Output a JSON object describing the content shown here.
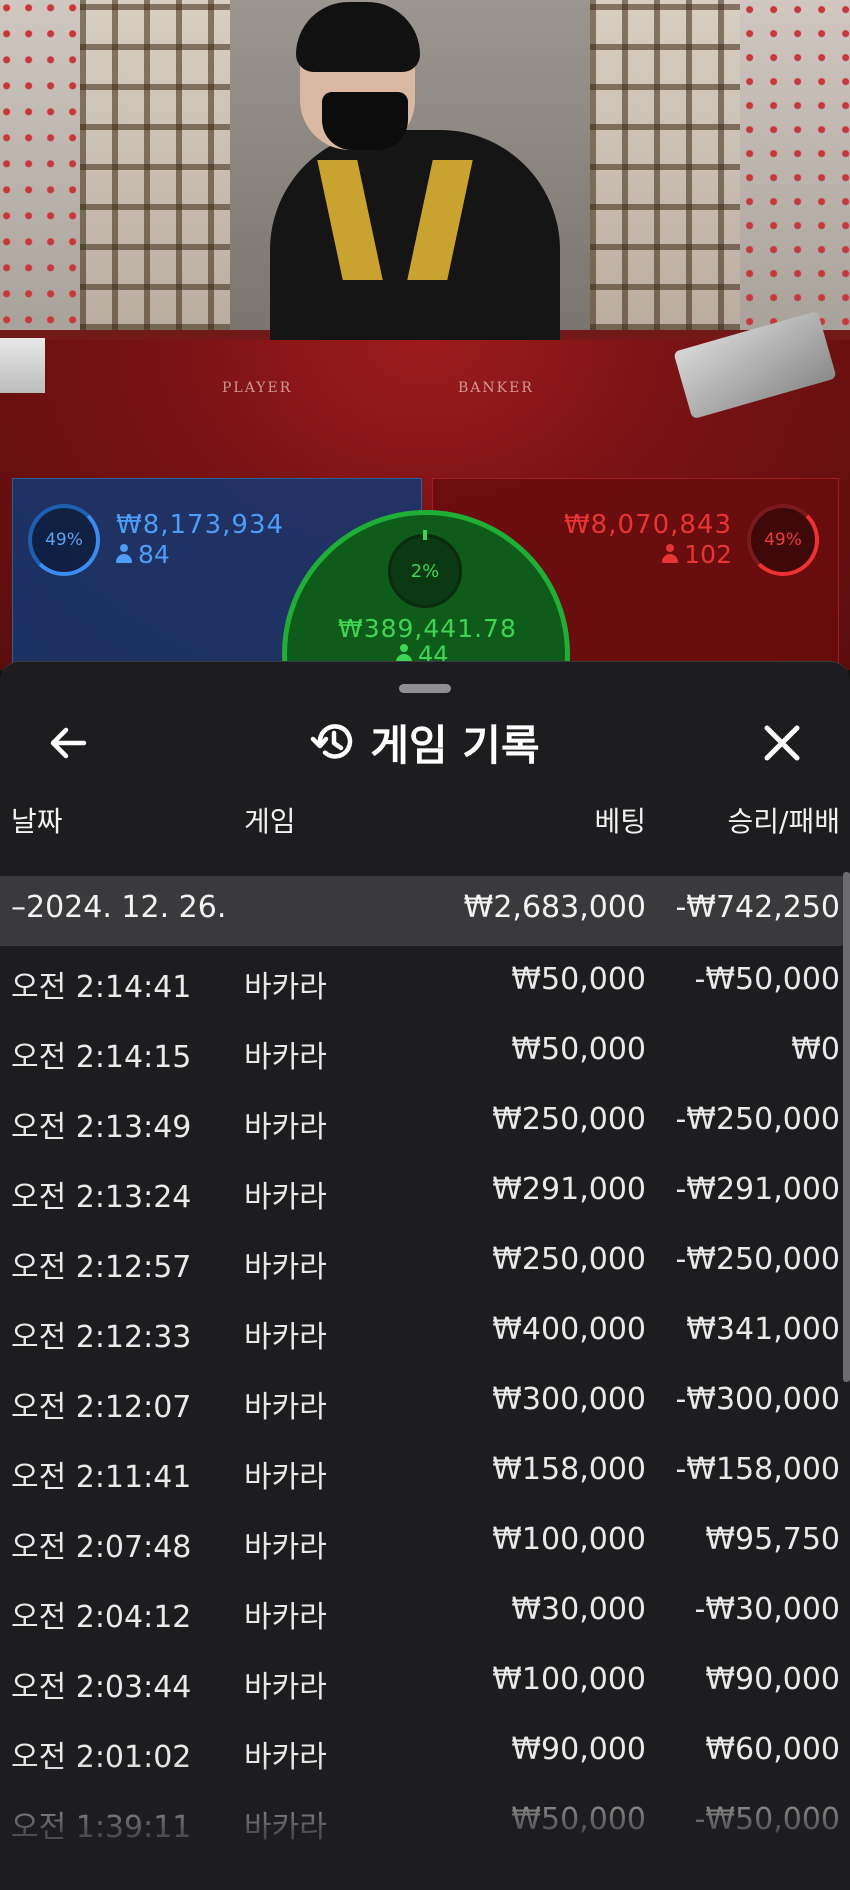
{
  "table": {
    "player_label": "PLAYER",
    "banker_label": "BANKER"
  },
  "bets": {
    "player": {
      "percent": "49%",
      "amount": "₩8,173,934",
      "players": "84"
    },
    "banker": {
      "percent": "49%",
      "amount": "₩8,070,843",
      "players": "102"
    },
    "tie": {
      "percent": "2%",
      "amount": "₩389,441.78",
      "players": "44"
    }
  },
  "history": {
    "title": "게임 기록",
    "columns": {
      "date": "날짜",
      "game": "게임",
      "bet": "베팅",
      "result": "승리/패배"
    },
    "date_group": {
      "date": "–2024. 12. 26.",
      "bet": "₩2,683,000",
      "result": "-₩742,250"
    },
    "rows": [
      {
        "time": "오전 2:14:41",
        "game": "바카라",
        "bet": "₩50,000",
        "result": "-₩50,000"
      },
      {
        "time": "오전 2:14:15",
        "game": "바카라",
        "bet": "₩50,000",
        "result": "₩0"
      },
      {
        "time": "오전 2:13:49",
        "game": "바카라",
        "bet": "₩250,000",
        "result": "-₩250,000"
      },
      {
        "time": "오전 2:13:24",
        "game": "바카라",
        "bet": "₩291,000",
        "result": "-₩291,000"
      },
      {
        "time": "오전 2:12:57",
        "game": "바카라",
        "bet": "₩250,000",
        "result": "-₩250,000"
      },
      {
        "time": "오전 2:12:33",
        "game": "바카라",
        "bet": "₩400,000",
        "result": "₩341,000"
      },
      {
        "time": "오전 2:12:07",
        "game": "바카라",
        "bet": "₩300,000",
        "result": "-₩300,000"
      },
      {
        "time": "오전 2:11:41",
        "game": "바카라",
        "bet": "₩158,000",
        "result": "-₩158,000"
      },
      {
        "time": "오전 2:07:48",
        "game": "바카라",
        "bet": "₩100,000",
        "result": "₩95,750"
      },
      {
        "time": "오전 2:04:12",
        "game": "바카라",
        "bet": "₩30,000",
        "result": "-₩30,000"
      },
      {
        "time": "오전 2:03:44",
        "game": "바카라",
        "bet": "₩100,000",
        "result": "₩90,000"
      },
      {
        "time": "오전 2:01:02",
        "game": "바카라",
        "bet": "₩90,000",
        "result": "₩60,000"
      },
      {
        "time": "오전 1:39:11",
        "game": "바카라",
        "bet": "₩50,000",
        "result": "-₩50,000"
      }
    ]
  },
  "icons": {
    "back": "arrow-left-icon",
    "history": "history-clock-icon",
    "close": "close-icon",
    "user": "user-icon"
  },
  "colors": {
    "player": "#4d9cf5",
    "banker": "#e83434",
    "tie": "#3fd455",
    "sheet_bg": "#1d1d1f",
    "date_row_bg": "#3a3a3d"
  }
}
